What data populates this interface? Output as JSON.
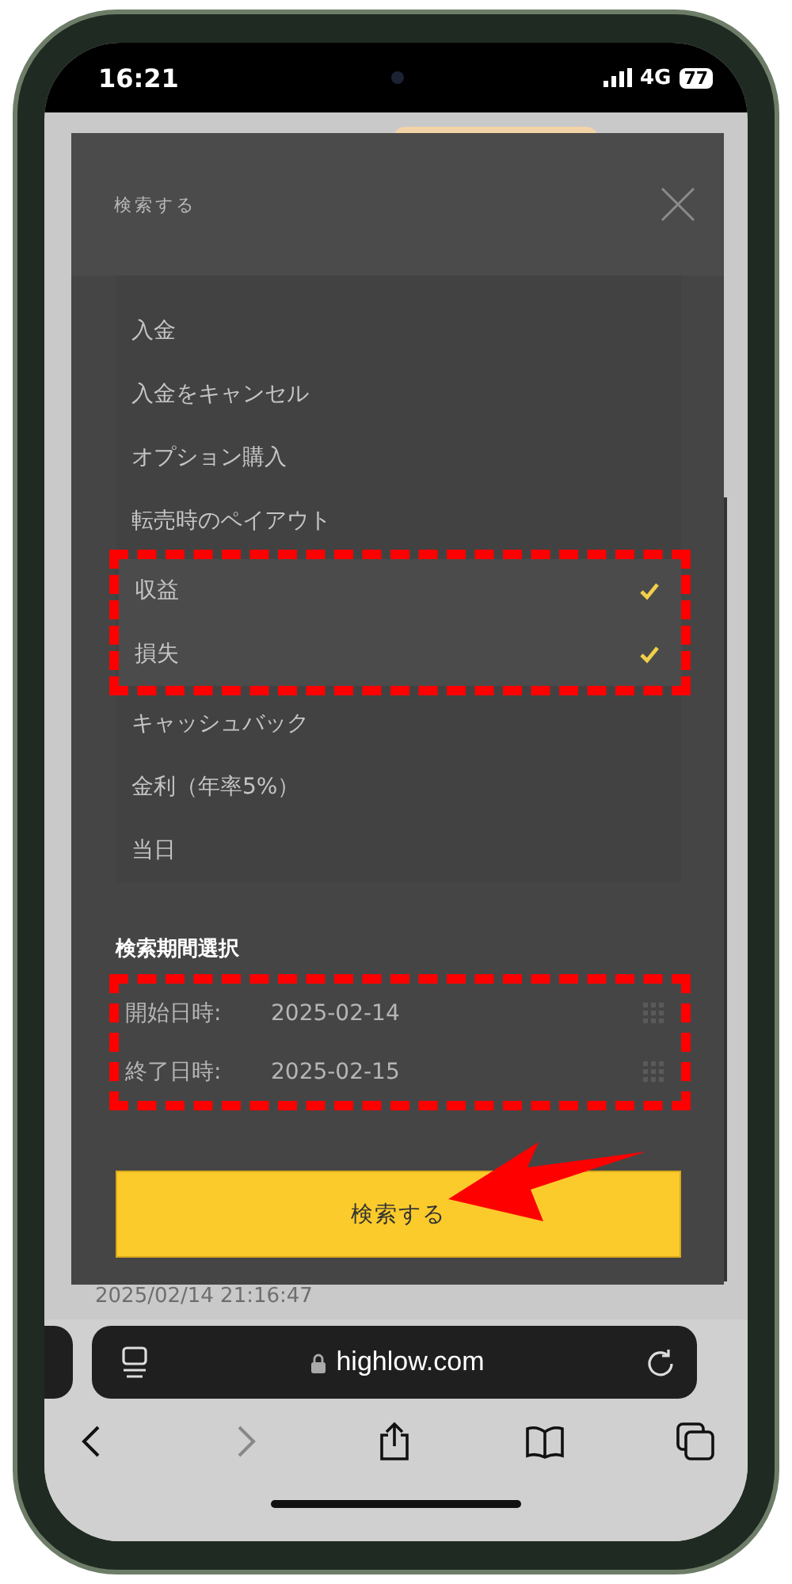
{
  "status_bar": {
    "time": "16:21",
    "network": "4G",
    "battery": "77"
  },
  "modal": {
    "title": "検索する",
    "items": [
      {
        "label": "入金",
        "checked": false
      },
      {
        "label": "入金をキャンセル",
        "checked": false
      },
      {
        "label": "オプション購入",
        "checked": false
      },
      {
        "label": "転売時のペイアウト",
        "checked": false
      },
      {
        "label": "収益",
        "checked": true
      },
      {
        "label": "損失",
        "checked": true
      },
      {
        "label": "キャッシュバック",
        "checked": false
      },
      {
        "label": "金利（年率5%）",
        "checked": false
      },
      {
        "label": "当日",
        "checked": false
      }
    ],
    "period": {
      "heading": "検索期間選択",
      "fields": [
        {
          "label": "開始日時:",
          "value": "2025-02-14"
        },
        {
          "label": "終了日時:",
          "value": "2025-02-15"
        }
      ]
    },
    "button": "検索する"
  },
  "background_timestamp": "2025/02/14 21:16:47",
  "browser": {
    "url": "highlow.com"
  }
}
